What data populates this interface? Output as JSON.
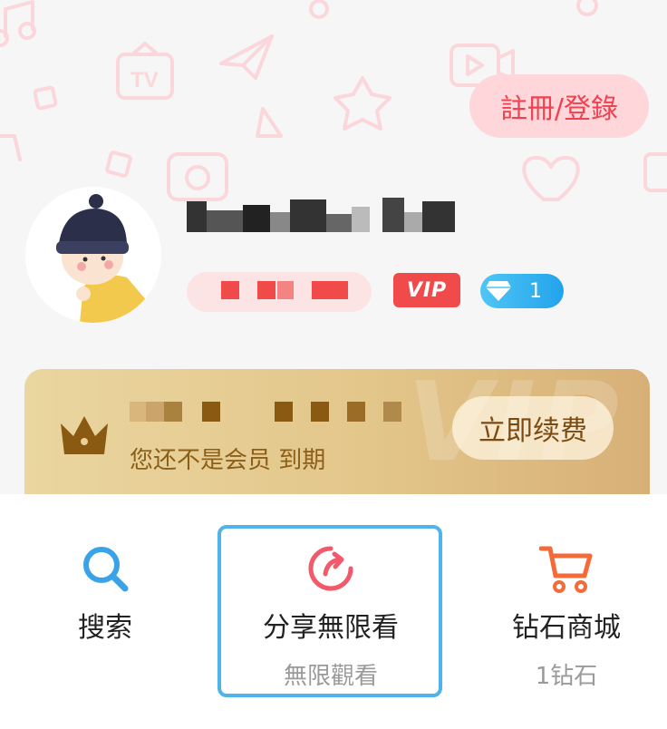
{
  "header": {
    "register_label": "註冊/登錄"
  },
  "profile": {
    "vip_badge": "VIP",
    "diamond_count": "1"
  },
  "vip_card": {
    "watermark": "VIP",
    "status_text": "您还不是会员 到期",
    "renew_label": "立即续费"
  },
  "actions": [
    {
      "label": "搜索",
      "sub": "",
      "icon": "search-icon",
      "color": "#3aa3e8"
    },
    {
      "label": "分享無限看",
      "sub": "無限觀看",
      "icon": "share-icon",
      "color": "#f05a6a"
    },
    {
      "label": "钻石商城",
      "sub": "1钻石",
      "icon": "cart-icon",
      "color": "#f46a38"
    }
  ],
  "colors": {
    "accent_red": "#ef4150",
    "vip_gold": "#e3c68a",
    "focus_blue": "#4fb4ea"
  }
}
